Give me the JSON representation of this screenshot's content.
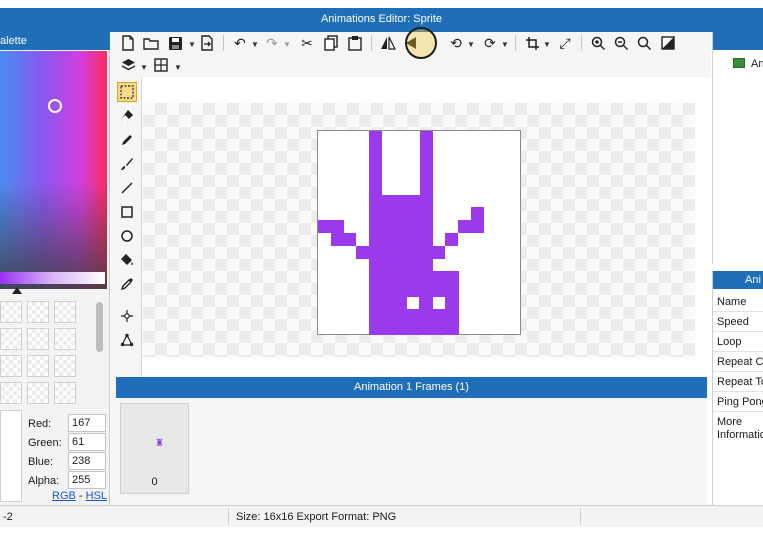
{
  "window": {
    "title": "Animations Editor: Sprite"
  },
  "palette": {
    "header": "alette",
    "fields": [
      {
        "label": "Red:",
        "value": "167"
      },
      {
        "label": "Green:",
        "value": "61"
      },
      {
        "label": "Blue:",
        "value": "238"
      },
      {
        "label": "Alpha:",
        "value": "255"
      }
    ],
    "mode_links": {
      "rgb": "RGB",
      "separator": " - ",
      "hsl": "HSL"
    }
  },
  "toolbar": {
    "icons": [
      "new-file-icon",
      "open-folder-icon",
      "save-icon",
      "export-icon",
      "undo-icon",
      "redo-icon",
      "cut-icon",
      "copy-icon",
      "paste-icon",
      "flip-horizontal-icon",
      "flip-vertical-icon",
      "rotate-left-icon",
      "rotate-right-icon",
      "crop-icon",
      "resize-icon",
      "zoom-in-icon",
      "zoom-out-icon",
      "zoom-fit-icon",
      "background-icon",
      "layers-icon",
      "grid-icon"
    ]
  },
  "tools": [
    "select-icon",
    "eraser-icon",
    "pencil-icon",
    "brush-icon",
    "line-icon",
    "rectangle-icon",
    "ellipse-icon",
    "fill-icon",
    "eyedropper-icon",
    "move-point-icon",
    "transform-icon"
  ],
  "canvas": {
    "sprite_color": "#9a3aea"
  },
  "frames_panel": {
    "header": "Animation 1 Frames (1)",
    "frames": [
      {
        "index": "0"
      }
    ]
  },
  "animations_panel": {
    "item_label": "An"
  },
  "properties_panel": {
    "header": "Ani",
    "rows": [
      "Name",
      "Speed",
      "Loop",
      "Repeat Co",
      "Repeat To",
      "Ping Pong",
      "More",
      "Informatio"
    ]
  },
  "status": {
    "position": "-2",
    "info": "Size: 16x16   Export Format: PNG"
  }
}
